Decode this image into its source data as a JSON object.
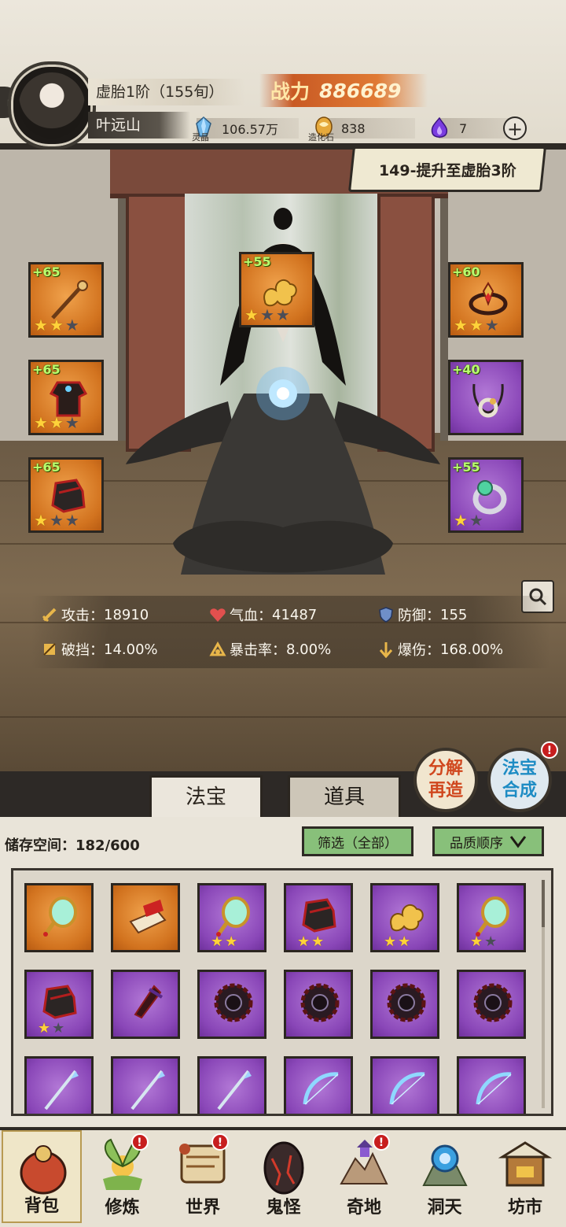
{
  "player": {
    "realm": "虚胎1阶（155旬）",
    "name": "叶远山",
    "power_label": "战力",
    "power_value": "886689"
  },
  "resources": [
    {
      "icon": "spirit-crystal-icon",
      "label": "灵晶",
      "value": "106.57万"
    },
    {
      "icon": "creation-stone-icon",
      "label": "造化石",
      "value": "838"
    },
    {
      "icon": "purple-flame-icon",
      "label": "",
      "value": "7"
    }
  ],
  "quest": {
    "text": "149-提升至虚胎3阶"
  },
  "equipment": [
    {
      "slot": "weapon",
      "level": "+65",
      "quality": "orange",
      "stars": 2,
      "max_stars": 3
    },
    {
      "slot": "top-artifact",
      "level": "+55",
      "quality": "orange",
      "stars": 1,
      "max_stars": 3
    },
    {
      "slot": "headband",
      "level": "+60",
      "quality": "orange",
      "stars": 2,
      "max_stars": 3
    },
    {
      "slot": "armor",
      "level": "+65",
      "quality": "orange",
      "stars": 2,
      "max_stars": 3
    },
    {
      "slot": "necklace",
      "level": "+40",
      "quality": "purple",
      "stars": 0,
      "max_stars": 0
    },
    {
      "slot": "boots",
      "level": "+65",
      "quality": "orange",
      "stars": 1,
      "max_stars": 3
    },
    {
      "slot": "ring",
      "level": "+55",
      "quality": "purple",
      "stars": 1,
      "max_stars": 2
    }
  ],
  "stats": [
    {
      "label": "攻击：",
      "value": "18910",
      "icon": "sword-icon"
    },
    {
      "label": "气血：",
      "value": "41487",
      "icon": "heart-icon"
    },
    {
      "label": "防御：",
      "value": "155",
      "icon": "shield-icon"
    },
    {
      "label": "破挡：",
      "value": "14.00%",
      "icon": "break-icon"
    },
    {
      "label": "暴击率：",
      "value": "8.00%",
      "icon": "crit-icon"
    },
    {
      "label": "爆伤：",
      "value": "168.00%",
      "icon": "crit-damage-icon"
    }
  ],
  "tabs": [
    {
      "label": "法宝",
      "active": true
    },
    {
      "label": "道具",
      "active": false
    }
  ],
  "actions": {
    "decompose_line1": "分解",
    "decompose_line2": "再造",
    "synthesize_line1": "法宝",
    "synthesize_line2": "合成",
    "synthesize_badge": "!"
  },
  "storage": {
    "label": "储存空间：",
    "value": "182/600",
    "filter": "筛选（全部）",
    "sort": "品质顺序"
  },
  "inventory": [
    {
      "item": "jade-mirror",
      "quality": "orange",
      "stars": 0,
      "max_stars": 0
    },
    {
      "item": "gauntlet",
      "quality": "orange",
      "stars": 0,
      "max_stars": 0
    },
    {
      "item": "jade-mirror",
      "quality": "purple",
      "stars": 2,
      "max_stars": 2
    },
    {
      "item": "boots",
      "quality": "purple",
      "stars": 2,
      "max_stars": 2
    },
    {
      "item": "golden-cloud",
      "quality": "purple",
      "stars": 2,
      "max_stars": 2
    },
    {
      "item": "jade-mirror",
      "quality": "purple",
      "stars": 1,
      "max_stars": 2
    },
    {
      "item": "boots",
      "quality": "purple",
      "stars": 1,
      "max_stars": 2
    },
    {
      "item": "dagger",
      "quality": "purple",
      "stars": 0,
      "max_stars": 0
    },
    {
      "item": "dark-wheel",
      "quality": "purple",
      "stars": 0,
      "max_stars": 0
    },
    {
      "item": "dark-wheel",
      "quality": "purple",
      "stars": 0,
      "max_stars": 0
    },
    {
      "item": "dark-wheel",
      "quality": "purple",
      "stars": 0,
      "max_stars": 0
    },
    {
      "item": "dark-wheel",
      "quality": "purple",
      "stars": 0,
      "max_stars": 0
    },
    {
      "item": "spear",
      "quality": "purple",
      "stars": 0,
      "max_stars": 0
    },
    {
      "item": "spear",
      "quality": "purple",
      "stars": 0,
      "max_stars": 0
    },
    {
      "item": "spear",
      "quality": "purple",
      "stars": 0,
      "max_stars": 0
    },
    {
      "item": "ice-bow",
      "quality": "purple",
      "stars": 0,
      "max_stars": 0
    },
    {
      "item": "ice-bow",
      "quality": "purple",
      "stars": 0,
      "max_stars": 0
    },
    {
      "item": "ice-bow",
      "quality": "purple",
      "stars": 0,
      "max_stars": 0
    }
  ],
  "nav": [
    {
      "label": "背包",
      "icon": "backpack-icon",
      "active": true,
      "badge": false
    },
    {
      "label": "修炼",
      "icon": "cultivate-icon",
      "active": false,
      "badge": true
    },
    {
      "label": "世界",
      "icon": "world-icon",
      "active": false,
      "badge": true
    },
    {
      "label": "鬼怪",
      "icon": "ghost-icon",
      "active": false,
      "badge": false
    },
    {
      "label": "奇地",
      "icon": "mystic-land-icon",
      "active": false,
      "badge": true
    },
    {
      "label": "洞天",
      "icon": "cave-heaven-icon",
      "active": false,
      "badge": false
    },
    {
      "label": "坊市",
      "icon": "market-icon",
      "active": false,
      "badge": false
    }
  ],
  "colors": {
    "orange_slot": "#d2731f",
    "purple_slot": "#8a47b8",
    "power_accent": "#e07a34",
    "level_text": "#b9ff6e",
    "filter_green": "#88c07a",
    "badge_red": "#c71e1e"
  }
}
